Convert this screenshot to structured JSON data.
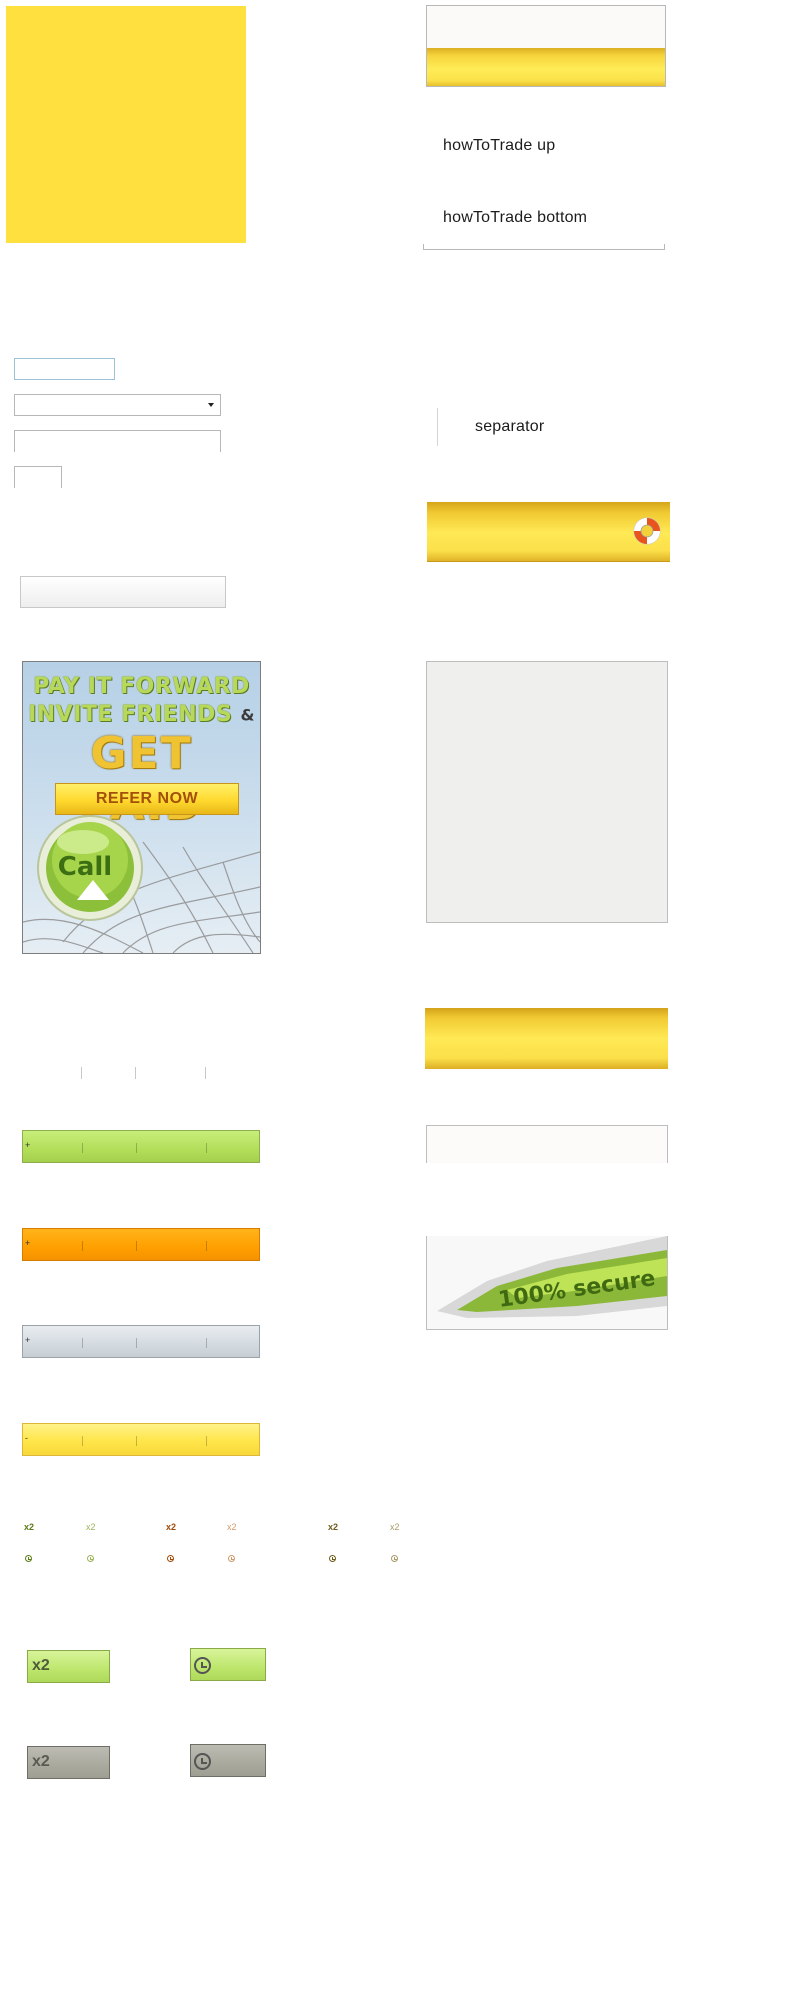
{
  "labels": {
    "how_to_trade_up": "howToTrade up",
    "how_to_trade_bottom": "howToTrade bottom",
    "separator": "separator"
  },
  "promo": {
    "line1": "PAY IT FORWARD",
    "line2": "INVITE FRIENDS",
    "ampersand": "&",
    "line3": "GET PAID",
    "button": "REFER NOW",
    "call_label": "Call"
  },
  "secure": {
    "text": "100% secure"
  },
  "bars": {
    "green_symbol": "+",
    "orange_symbol": "+",
    "silver_symbol": "+",
    "yellow_symbol": "-"
  },
  "multipliers": {
    "label": "x2"
  },
  "icons": {
    "lifering": "lifering-icon",
    "clock": "clock-icon"
  },
  "colors": {
    "accent_yellow": "#ffe03e",
    "green": "#b3de5a",
    "orange": "#ff9f00",
    "silver": "#d5dce1"
  }
}
